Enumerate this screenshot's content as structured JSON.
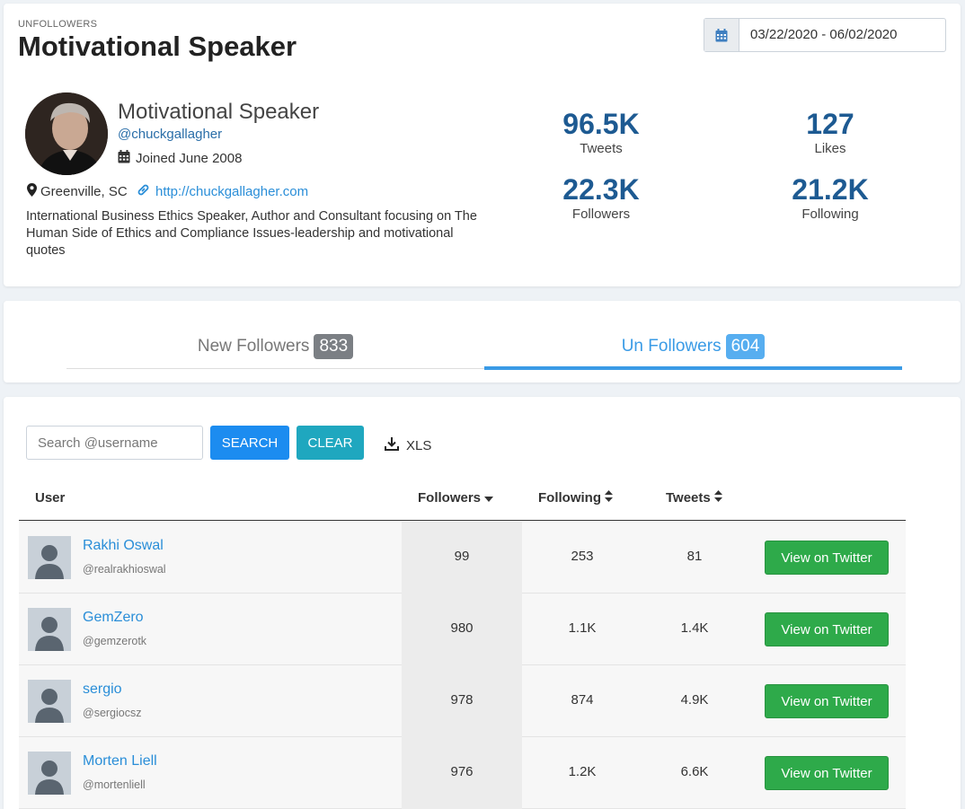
{
  "header": {
    "overline": "UNFOLLOWERS",
    "title": "Motivational Speaker",
    "date_range": "03/22/2020 - 06/02/2020"
  },
  "profile": {
    "name": "Motivational Speaker",
    "handle": "@chuckgallagher",
    "joined": "Joined June 2008",
    "location": "Greenville, SC",
    "url": "http://chuckgallagher.com",
    "bio": "International Business Ethics Speaker, Author and Consultant focusing on The Human Side of Ethics and Compliance Issues-leadership and motivational quotes"
  },
  "stats": {
    "tweets": {
      "value": "96.5K",
      "label": "Tweets"
    },
    "likes": {
      "value": "127",
      "label": "Likes"
    },
    "followers": {
      "value": "22.3K",
      "label": "Followers"
    },
    "following": {
      "value": "21.2K",
      "label": "Following"
    }
  },
  "tabs": [
    {
      "label": "New Followers",
      "count": "833",
      "active": false
    },
    {
      "label": "Un Followers",
      "count": "604",
      "active": true
    }
  ],
  "toolbar": {
    "search_placeholder": "Search @username",
    "search_label": "SEARCH",
    "clear_label": "CLEAR",
    "xls_label": "XLS"
  },
  "table": {
    "columns": {
      "user": "User",
      "followers": "Followers",
      "following": "Following",
      "tweets": "Tweets"
    },
    "sorted_by": "followers",
    "action_label": "View on Twitter",
    "rows": [
      {
        "name": "Rakhi Oswal",
        "handle": "@realrakhioswal",
        "followers": "99",
        "following": "253",
        "tweets": "81"
      },
      {
        "name": "GemZero",
        "handle": "@gemzerotk",
        "followers": "980",
        "following": "1.1K",
        "tweets": "1.4K"
      },
      {
        "name": "sergio",
        "handle": "@sergiocsz",
        "followers": "978",
        "following": "874",
        "tweets": "4.9K"
      },
      {
        "name": "Morten Liell",
        "handle": "@mortenliell",
        "followers": "976",
        "following": "1.2K",
        "tweets": "6.6K"
      }
    ]
  },
  "colors": {
    "accent": "#3a9be6",
    "stat_value": "#1d5a92",
    "link": "#2a8ed8",
    "search_button": "#1c8cf0",
    "clear_button": "#1fa7bf",
    "twitter_button": "#2eaa4a"
  },
  "icons": {
    "date": "calendar-icon",
    "joined": "calendar-grid-icon",
    "location": "map-marker-icon",
    "url": "link-icon",
    "export": "download-icon",
    "sort_desc": "caret-down-icon",
    "sort_both": "sort-icon",
    "row_avatar": "default-user-icon"
  }
}
